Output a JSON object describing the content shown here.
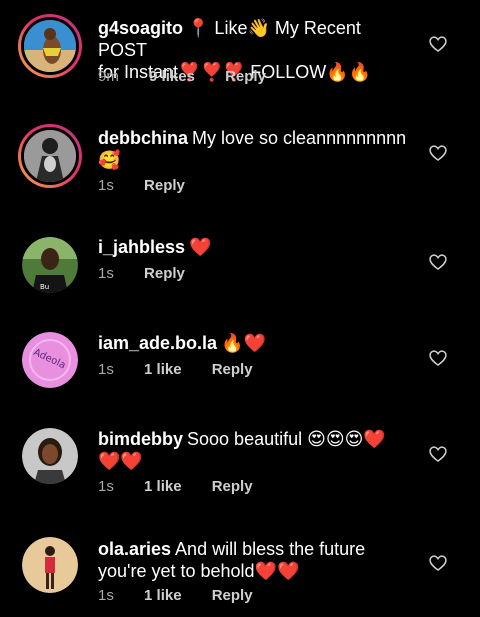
{
  "comments": [
    {
      "username": "g4soagito",
      "text_line1": "📍 Like👋 My Recent POST",
      "text_line2": "for Instant❣️❣️❣️ FOLLOW🔥🔥",
      "time": "9m",
      "likes": "9 likes",
      "reply": "Reply"
    },
    {
      "username": "debbchina",
      "text_line1": "My love so cleannnnnnnnn",
      "text_line2": "🥰",
      "time": "1s",
      "likes": "",
      "reply": "Reply"
    },
    {
      "username": "i_jahbless",
      "text_line1": "❤️",
      "text_line2": "",
      "time": "1s",
      "likes": "",
      "reply": "Reply"
    },
    {
      "username": "iam_ade.bo.la",
      "text_line1": "🔥❤️",
      "text_line2": "",
      "time": "1s",
      "likes": "1 like",
      "reply": "Reply"
    },
    {
      "username": "bimdebby",
      "text_line1": "Sooo beautiful 😍😍😍❤️",
      "text_line2": "❤️❤️",
      "time": "1s",
      "likes": "1 like",
      "reply": "Reply"
    },
    {
      "username": "ola.aries",
      "text_line1": "And will bless the future",
      "text_line2": "you're yet to behold❤️❤️",
      "time": "1s",
      "likes": "1 like",
      "reply": "Reply"
    }
  ],
  "icons": {
    "like": "heart-outline-icon"
  },
  "colors": {
    "background": "#000000",
    "meta_text": "#a8a8a8",
    "story_ring_start": "#f9a94a",
    "story_ring_end": "#c13584"
  }
}
